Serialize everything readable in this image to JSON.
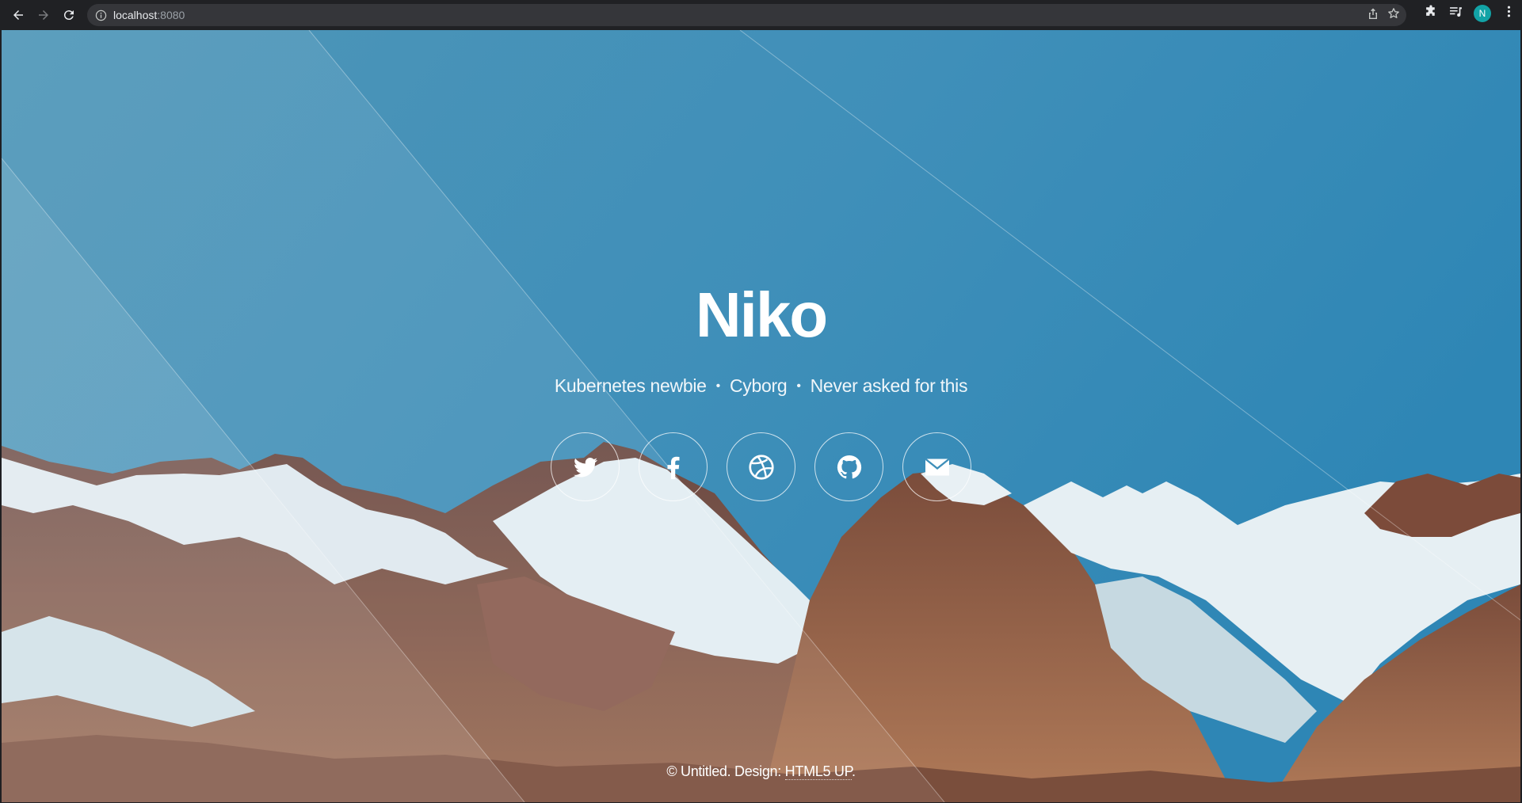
{
  "browser": {
    "url_host": "localhost",
    "url_port": ":8080",
    "profile_initial": "N"
  },
  "hero": {
    "title": "Niko",
    "tagline": [
      "Kubernetes newbie",
      "Cyborg",
      "Never asked for this"
    ],
    "tagline_separator": "•"
  },
  "social_links": [
    {
      "icon": "twitter-icon"
    },
    {
      "icon": "facebook-icon"
    },
    {
      "icon": "dribbble-icon"
    },
    {
      "icon": "github-icon"
    },
    {
      "icon": "email-icon"
    }
  ],
  "footer": {
    "copyright_text": "© Untitled. Design: ",
    "design_link": "HTML5 UP",
    "trailing": "."
  },
  "colors": {
    "sky": "#3a8fbd",
    "chrome_bg": "#202124",
    "omnibox_bg": "#35363a",
    "avatar": "#12a3a6"
  }
}
